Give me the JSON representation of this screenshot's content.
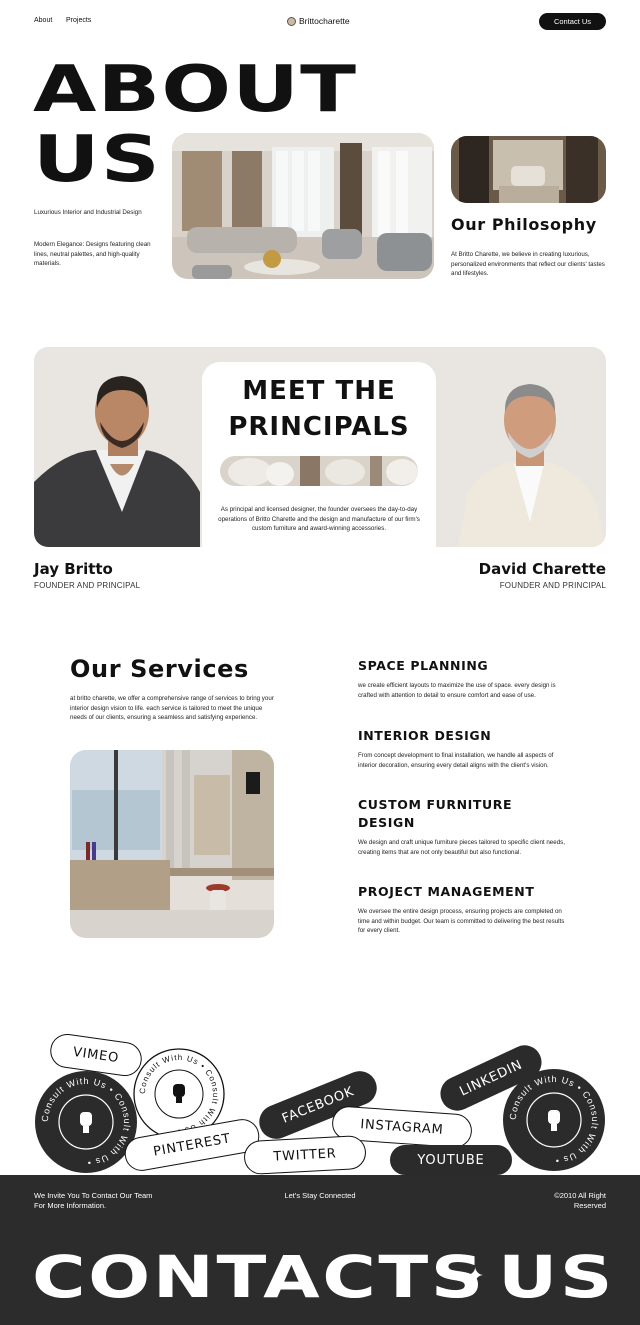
{
  "nav": {
    "about": "About",
    "projects": "Projects",
    "brand": "Brittocharette",
    "contact_button": "Contact Us"
  },
  "hero": {
    "title_line1": "ABOUT",
    "title_line2": "US",
    "tagline": "Luxurious Interior and Industrial Design",
    "description": "Modern Elegance: Designs featuring clean lines, neutral palettes, and high-quality materials."
  },
  "philosophy": {
    "heading": "Our Philosophy",
    "text": "At Britto Charette, we believe in creating luxurious, personalized environments that reflect our clients' tastes and lifestyles."
  },
  "principals": {
    "title_line1": "MEET THE",
    "title_line2": "PRINCIPALS",
    "description": "As principal and licensed designer, the founder oversees the day-to-day operations of Britto Charette and the design and manufacture of our firm's custom furniture and award-winning accessories.",
    "people": [
      {
        "name": "Jay Britto",
        "role": "FOUNDER AND PRINCIPAL"
      },
      {
        "name": "David Charette",
        "role": "FOUNDER AND PRINCIPAL"
      }
    ]
  },
  "services": {
    "heading": "Our Services",
    "intro": "at britto charette, we offer a comprehensive range of services to bring your interior design vision to life. each service is tailored to meet the unique needs of our clients, ensuring a seamless and satisfying experience.",
    "items": [
      {
        "title": "SPACE PLANNING",
        "text": "we create efficient layouts to maximize the use of space. every design is crafted with attention to detail to ensure comfort and ease of use."
      },
      {
        "title": "INTERIOR DESIGN",
        "text": "From concept development to final installation, we handle all aspects of interior decoration, ensuring every detail aligns with the client's vision."
      },
      {
        "title_line1": "CUSTOM FURNITURE",
        "title_line2": "DESIGN",
        "text": "We design and craft unique furniture pieces tailored to specific client needs, creating items that are not only beautiful but also functional."
      },
      {
        "title": "PROJECT MANAGEMENT",
        "text": "We oversee the entire design process, ensuring projects are completed on time and within budget. Our team is committed to delivering the best results for every client."
      }
    ]
  },
  "social": {
    "vimeo": "VIMEO",
    "facebook": "FACEBOOK",
    "linkedin": "LINKEDIN",
    "pinterest": "PINTEREST",
    "instagram": "INSTAGRAM",
    "twitter": "TWITTER",
    "youtube": "YOUTUBE",
    "badge_text": "Consult With Us • Consult With Us •"
  },
  "footer": {
    "invite": "We Invite You To Contact Our Team For More Information.",
    "stay": "Let's Stay Connected",
    "copyright": "©2010 All Right Reserved",
    "big_left": "CONTACTS",
    "big_star": "✦",
    "big_right": "US"
  },
  "colors": {
    "dark": "#2c2c2c",
    "card_bg": "#e9e6e2",
    "accent": "#cfb9a4"
  }
}
